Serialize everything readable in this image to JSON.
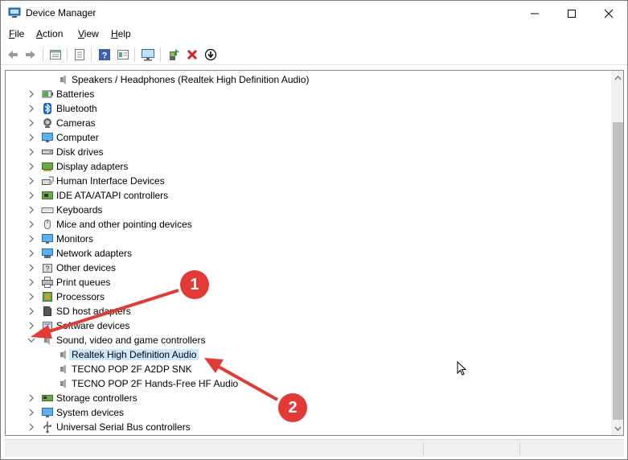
{
  "window": {
    "title": "Device Manager",
    "controls": {
      "minimize": "minimize",
      "maximize": "maximize",
      "close": "close"
    }
  },
  "menu": {
    "file_u": "F",
    "file_rest": "ile",
    "action_u": "A",
    "action_rest": "ction",
    "view_u": "V",
    "view_rest": "iew",
    "help_u": "H",
    "help_rest": "elp"
  },
  "toolbar": {
    "buttons": [
      "back-icon",
      "forward-icon",
      "properties-icon",
      "update-list-icon",
      "help-icon",
      "details-icon",
      "monitor-icon",
      "update-driver-icon",
      "uninstall-icon",
      "download-icon"
    ]
  },
  "tree": {
    "partial_top": "Speakers / Headphones (Realtek High Definition Audio)",
    "categories": [
      "Batteries",
      "Bluetooth",
      "Cameras",
      "Computer",
      "Disk drives",
      "Display adapters",
      "Human Interface Devices",
      "IDE ATA/ATAPI controllers",
      "Keyboards",
      "Mice and other pointing devices",
      "Monitors",
      "Network adapters",
      "Other devices",
      "Print queues",
      "Processors",
      "SD host adapters",
      "Software devices",
      "Sound, video and game controllers"
    ],
    "sound_children": [
      "Realtek High Definition Audio",
      "TECNO POP 2F A2DP SNK",
      "TECNO POP 2F Hands-Free HF Audio"
    ],
    "after_categories": [
      "Storage controllers",
      "System devices",
      "Universal Serial Bus controllers"
    ]
  },
  "annotations": {
    "badge1": "1",
    "badge2": "2",
    "color": "#e53935"
  }
}
